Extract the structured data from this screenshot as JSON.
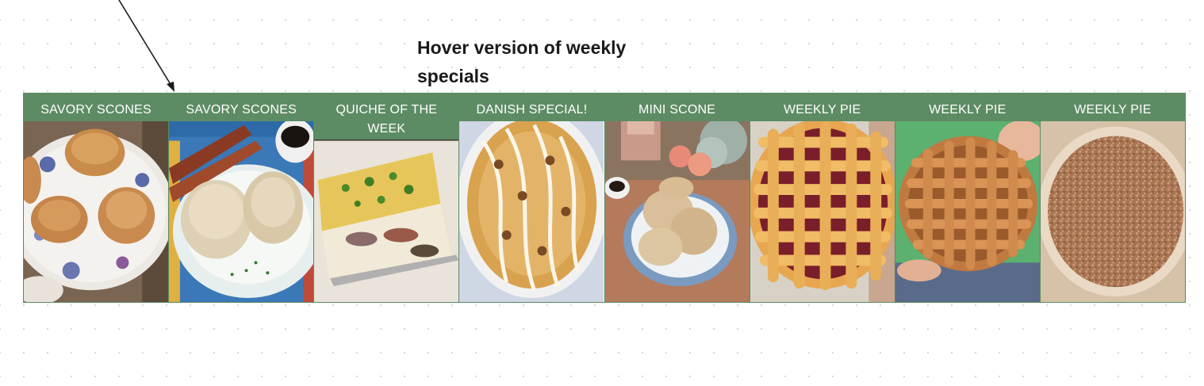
{
  "canvas": {
    "note": "Hover version of weekly specials"
  },
  "specials": {
    "items": [
      {
        "label": "SAVORY SCONES",
        "photo": "savory-scones-photo"
      },
      {
        "label": "SAVORY SCONES",
        "photo": "savory-scones-bacon-photo"
      },
      {
        "label": "QUICHE OF THE WEEK",
        "photo": "quiche-photo"
      },
      {
        "label": "DANISH SPECIAL!",
        "photo": "danish-photo"
      },
      {
        "label": "MINI SCONE",
        "photo": "mini-scone-photo"
      },
      {
        "label": "WEEKLY PIE",
        "photo": "lattice-cherry-pie-photo"
      },
      {
        "label": "WEEKLY PIE",
        "photo": "lattice-apple-pie-photo"
      },
      {
        "label": "WEEKLY PIE",
        "photo": "crumb-pie-photo"
      }
    ],
    "colors": {
      "label_background": "#5d8c64",
      "label_text": "#ffffff",
      "border": "#5a8a62"
    }
  }
}
